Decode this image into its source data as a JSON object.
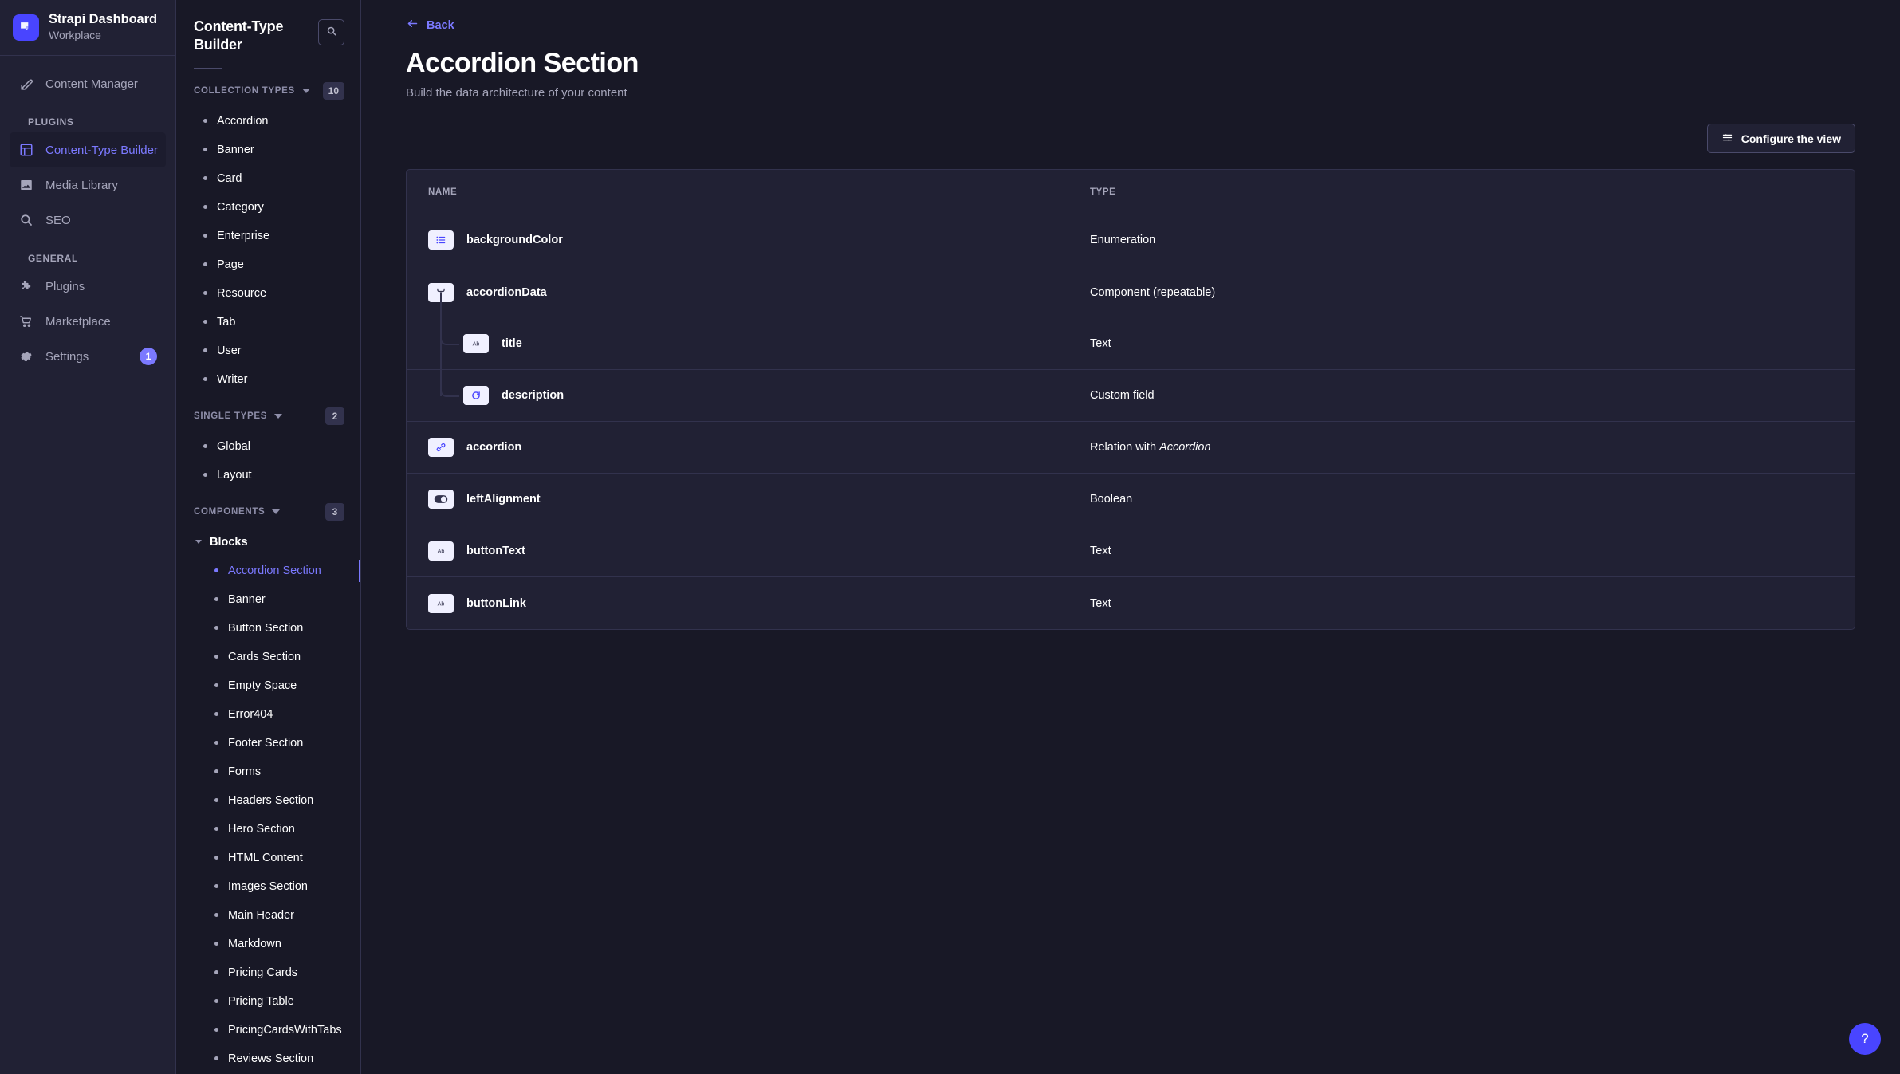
{
  "brand": {
    "title": "Strapi Dashboard",
    "subtitle": "Workplace",
    "logo_icon": "strapi-logo-icon",
    "accent": "#4945ff"
  },
  "nav": {
    "top_items": [
      {
        "label": "Content Manager",
        "icon": "pencil-square-icon",
        "active": false
      }
    ],
    "sections": [
      {
        "label": "PLUGINS",
        "items": [
          {
            "label": "Content-Type Builder",
            "icon": "layout-grid-icon",
            "active": true
          },
          {
            "label": "Media Library",
            "icon": "image-icon",
            "active": false
          },
          {
            "label": "SEO",
            "icon": "search-icon",
            "active": false
          }
        ]
      },
      {
        "label": "GENERAL",
        "items": [
          {
            "label": "Plugins",
            "icon": "puzzle-icon",
            "active": false
          },
          {
            "label": "Marketplace",
            "icon": "shopping-cart-icon",
            "active": false
          },
          {
            "label": "Settings",
            "icon": "gear-icon",
            "active": false,
            "badge": "1"
          }
        ]
      }
    ]
  },
  "ctlist": {
    "title": "Content-Type Builder",
    "search_icon": "search-icon",
    "groups": [
      {
        "label": "COLLECTION TYPES",
        "count": "10",
        "items": [
          {
            "label": "Accordion"
          },
          {
            "label": "Banner"
          },
          {
            "label": "Card"
          },
          {
            "label": "Category"
          },
          {
            "label": "Enterprise"
          },
          {
            "label": "Page"
          },
          {
            "label": "Resource"
          },
          {
            "label": "Tab"
          },
          {
            "label": "User"
          },
          {
            "label": "Writer"
          }
        ]
      },
      {
        "label": "SINGLE TYPES",
        "count": "2",
        "items": [
          {
            "label": "Global"
          },
          {
            "label": "Layout"
          }
        ]
      },
      {
        "label": "COMPONENTS",
        "count": "3",
        "group_name": "Blocks",
        "items": [
          {
            "label": "Accordion Section",
            "active": true
          },
          {
            "label": "Banner"
          },
          {
            "label": "Button Section"
          },
          {
            "label": "Cards Section"
          },
          {
            "label": "Empty Space"
          },
          {
            "label": "Error404"
          },
          {
            "label": "Footer Section"
          },
          {
            "label": "Forms"
          },
          {
            "label": "Headers Section"
          },
          {
            "label": "Hero Section"
          },
          {
            "label": "HTML Content"
          },
          {
            "label": "Images Section"
          },
          {
            "label": "Main Header"
          },
          {
            "label": "Markdown"
          },
          {
            "label": "Pricing Cards"
          },
          {
            "label": "Pricing Table"
          },
          {
            "label": "PricingCardsWithTabs"
          },
          {
            "label": "Reviews Section"
          }
        ]
      }
    ]
  },
  "main": {
    "back_label": "Back",
    "back_icon": "arrow-left-icon",
    "title": "Accordion Section",
    "subtitle": "Build the data architecture of your content",
    "configure_label": "Configure the view",
    "configure_icon": "sliders-icon",
    "help_label": "?",
    "table": {
      "columns": {
        "name": "NAME",
        "type": "TYPE"
      },
      "rows": [
        {
          "name": "backgroundColor",
          "type": "Enumeration",
          "icon": "enumeration-list-icon",
          "level": 0
        },
        {
          "name": "accordionData",
          "type": "Component (repeatable)",
          "icon": "component-branch-icon",
          "level": 0
        },
        {
          "name": "title",
          "type": "Text",
          "icon": "text-ab-icon",
          "level": 1
        },
        {
          "name": "description",
          "type": "Custom field",
          "icon": "custom-field-icon",
          "level": 1
        },
        {
          "name": "accordion",
          "type_prefix": "Relation with ",
          "type_em": "Accordion",
          "icon": "relation-link-icon",
          "level": 0
        },
        {
          "name": "leftAlignment",
          "type": "Boolean",
          "icon": "boolean-toggle-icon",
          "level": 0
        },
        {
          "name": "buttonText",
          "type": "Text",
          "icon": "text-ab-icon",
          "level": 0
        },
        {
          "name": "buttonLink",
          "type": "Text",
          "icon": "text-ab-icon",
          "level": 0
        }
      ]
    }
  }
}
